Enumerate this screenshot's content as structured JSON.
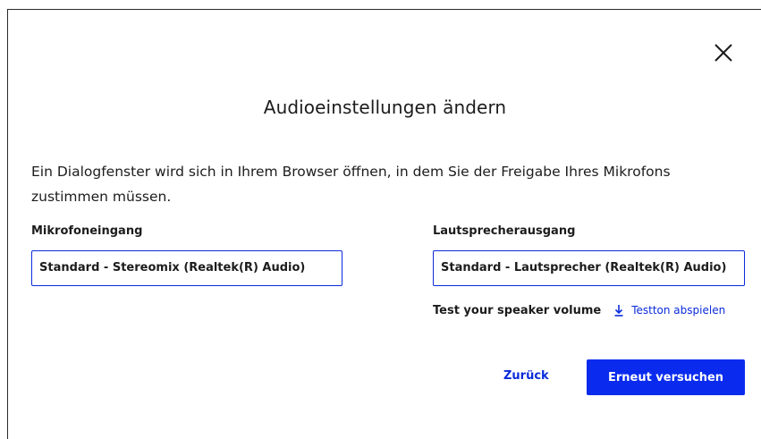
{
  "dialog": {
    "title": "Audioeinstellungen ändern",
    "description": "Ein Dialogfenster wird sich in Ihrem Browser öffnen, in dem Sie der Freigabe Ihres Mikrofons zustimmen müssen.",
    "close_icon": "close-icon"
  },
  "microphone": {
    "label": "Mikrofoneingang",
    "selected": "Standard - Stereomix (Realtek(R) Audio)"
  },
  "speaker": {
    "label": "Lautsprecherausgang",
    "selected": "Standard - Lautsprecher (Realtek(R) Audio)",
    "test_label": "Test your speaker volume",
    "play_label": "Testton abspielen",
    "play_icon": "download-arrow-icon"
  },
  "actions": {
    "back_label": "Zurück",
    "retry_label": "Erneut versuchen"
  },
  "colors": {
    "accent": "#0a2bee",
    "text": "#1c1c1c",
    "background": "#ffffff"
  }
}
